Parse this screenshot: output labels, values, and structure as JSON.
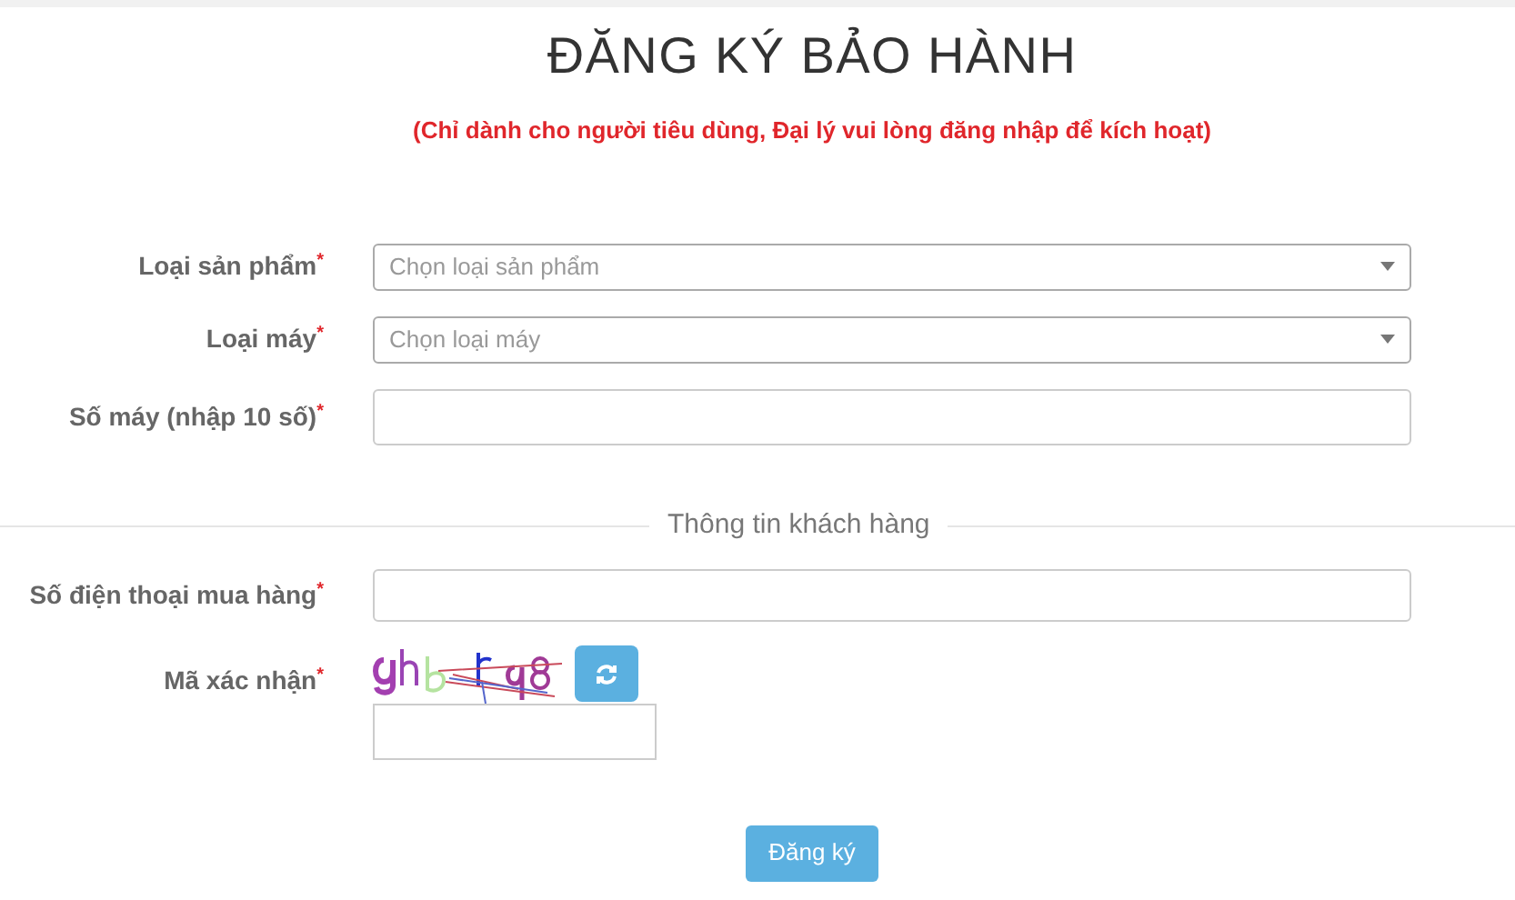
{
  "title": "ĐĂNG KÝ BẢO HÀNH",
  "subtitle": "(Chỉ dành cho người tiêu dùng, Đại lý vui lòng đăng nhập để kích hoạt)",
  "product_fields": [
    {
      "kind": "select",
      "label": "Loại sản phẩm",
      "required_mark": "*",
      "placeholder": "Chọn loại sản phẩm"
    },
    {
      "kind": "select",
      "label": "Loại máy",
      "required_mark": "*",
      "placeholder": "Chọn loại máy"
    },
    {
      "kind": "text",
      "label": "Số máy (nhập 10 số)",
      "required_mark": "*"
    }
  ],
  "section_title": "Thông tin khách hàng",
  "phone_field": {
    "label": "Số điện thoại mua hàng",
    "required_mark": "*"
  },
  "captcha": {
    "label": "Mã xác nhận",
    "required_mark": "*"
  },
  "submit_button": "Đăng ký"
}
